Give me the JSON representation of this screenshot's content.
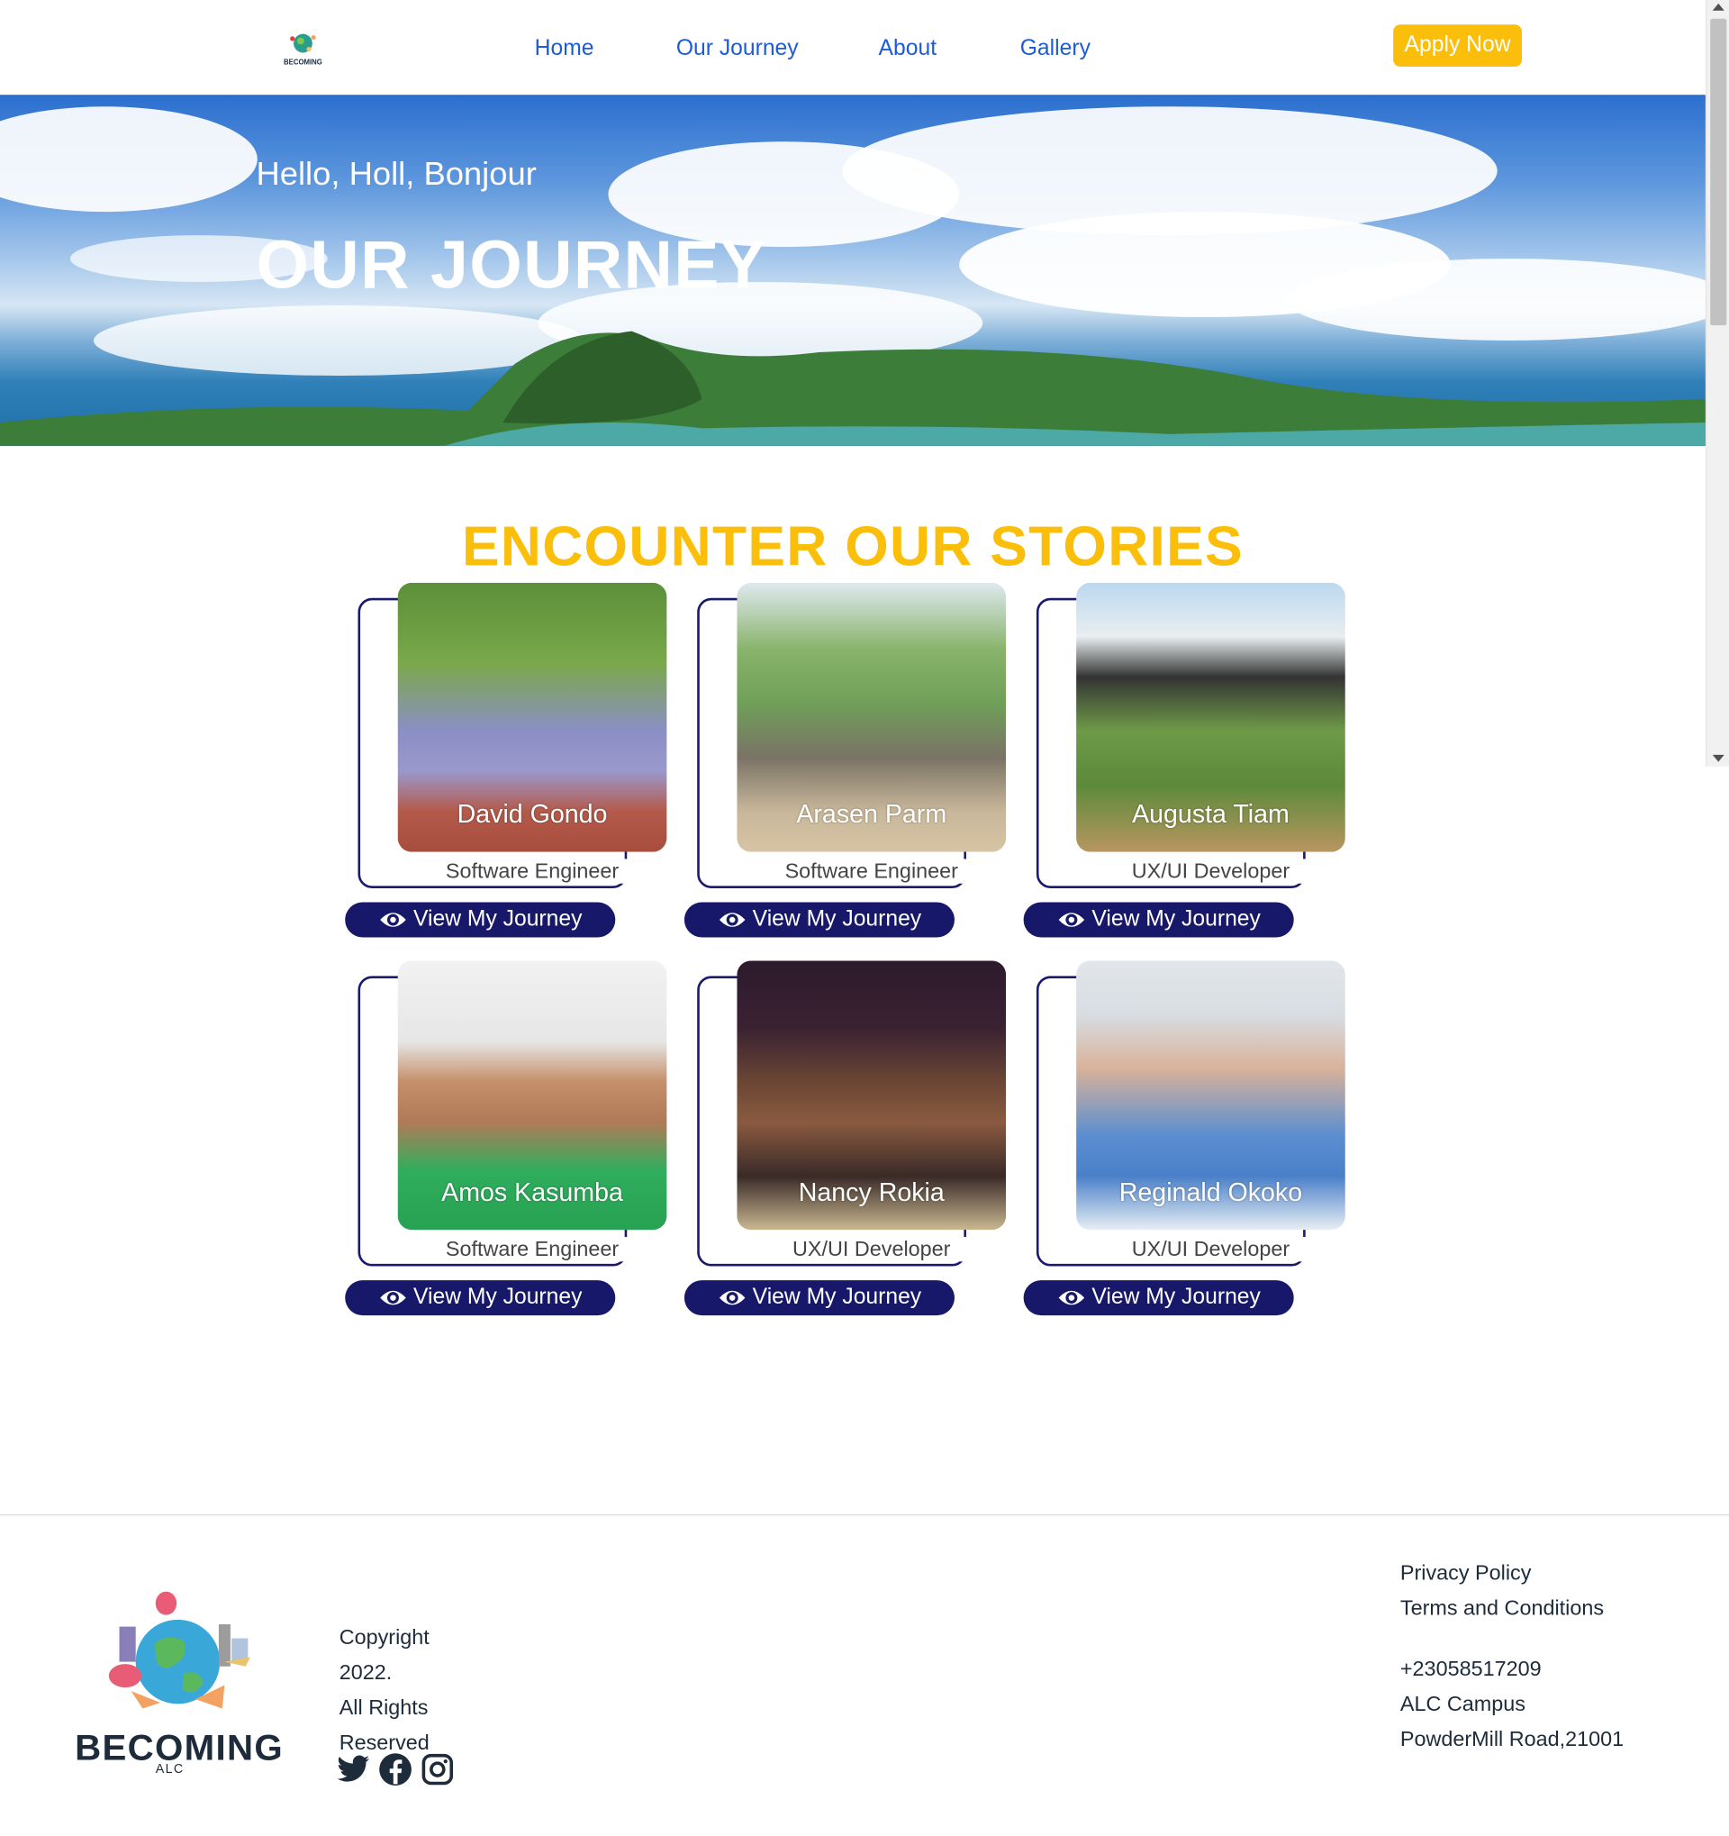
{
  "nav": {
    "logo_text": "BECOMING",
    "links": [
      "Home",
      "Our Journey",
      "About",
      "Gallery"
    ],
    "apply_label": "Apply Now"
  },
  "hero": {
    "greeting": "Hello, Holl, Bonjour",
    "title": "OUR JOURNEY"
  },
  "stories": {
    "title": "ENCOUNTER OUR STORIES",
    "view_label": "View My Journey",
    "people": [
      {
        "name": "David Gondo",
        "role": "Software Engineer"
      },
      {
        "name": "Arasen Parm",
        "role": "Software Engineer"
      },
      {
        "name": "Augusta Tiam",
        "role": "UX/UI Developer"
      },
      {
        "name": "Amos Kasumba",
        "role": "Software Engineer"
      },
      {
        "name": "Nancy Rokia",
        "role": "UX/UI Developer"
      },
      {
        "name": "Reginald Okoko",
        "role": "UX/UI Developer"
      }
    ]
  },
  "footer": {
    "brand": "BECOMING",
    "brand_sub": "ALC",
    "copyright_lines": [
      "Copyright",
      "2022.",
      "All Rights",
      "Reserved"
    ],
    "links": [
      "Privacy Policy",
      "Terms and Conditions"
    ],
    "phone": "+23058517209",
    "address_lines": [
      "ALC Campus",
      "PowderMill Road,21001"
    ],
    "social_icons": [
      "twitter-icon",
      "facebook-icon",
      "instagram-icon"
    ]
  },
  "colors": {
    "accent_yellow": "#fbbf0b",
    "nav_blue": "#1e5bd8",
    "button_navy": "#18186a"
  }
}
